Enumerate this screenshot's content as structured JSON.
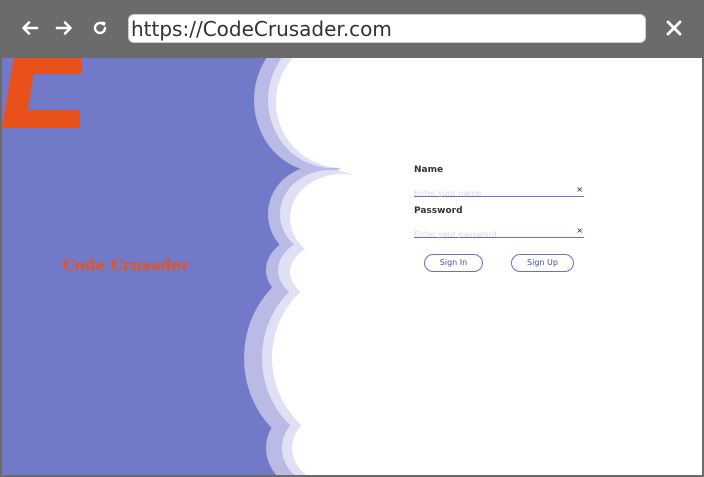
{
  "browser": {
    "url": "https://CodeCrusader.com",
    "back_icon": "arrow-left-icon",
    "forward_icon": "arrow-right-icon",
    "reload_icon": "reload-icon",
    "close_icon": "close-icon"
  },
  "brand": {
    "name": "Code Crusader",
    "logo_color": "#e8511a",
    "panel_color": "#7279c9"
  },
  "form": {
    "name_label": "Name",
    "name_placeholder": "Enter your name",
    "password_label": "Password",
    "password_placeholder": "Enter your password",
    "clear_glyph": "×",
    "sign_in_label": "Sign In",
    "sign_up_label": "Sign Up"
  }
}
